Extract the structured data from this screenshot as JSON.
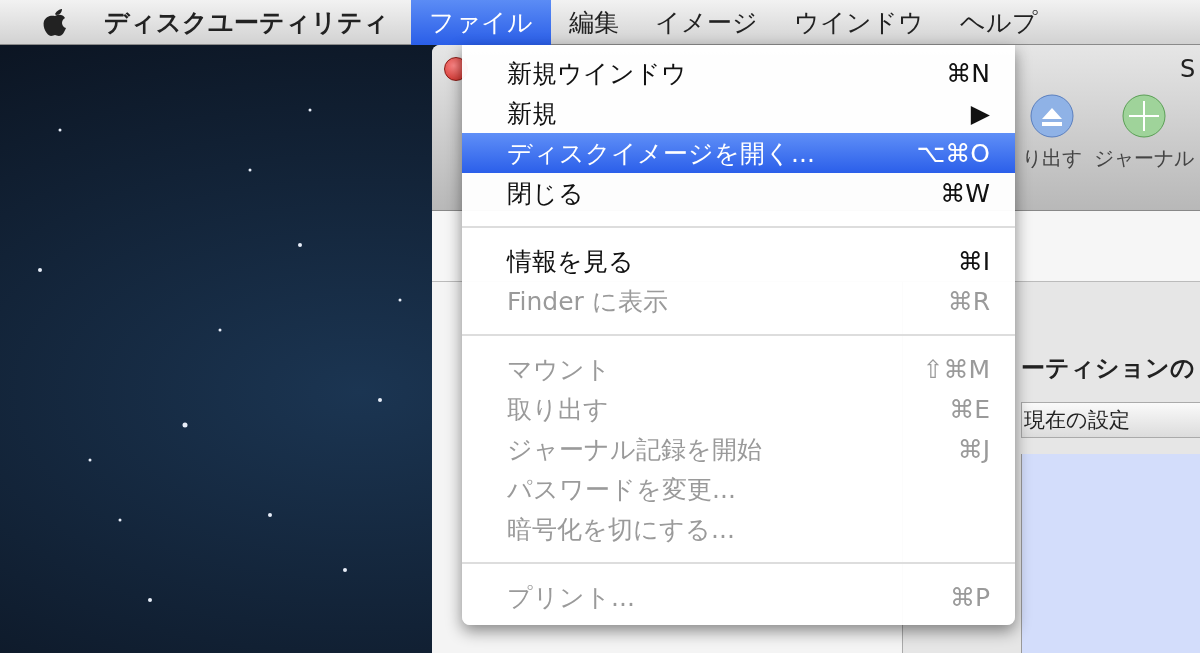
{
  "menubar": {
    "app": "ディスクユーティリティ",
    "menus": [
      {
        "label": "ファイル",
        "selected": true
      },
      {
        "label": "編集",
        "selected": false
      },
      {
        "label": "イメージ",
        "selected": false
      },
      {
        "label": "ウインドウ",
        "selected": false
      },
      {
        "label": "ヘルプ",
        "selected": false
      }
    ]
  },
  "menu": {
    "items": [
      {
        "kind": "item",
        "label": "新規ウインドウ",
        "shortcut": "⌘N",
        "disabled": false,
        "selected": false
      },
      {
        "kind": "item",
        "label": "新規",
        "shortcut": "▶",
        "disabled": false,
        "selected": false
      },
      {
        "kind": "item",
        "label": "ディスクイメージを開く...",
        "shortcut": "⌥⌘O",
        "disabled": false,
        "selected": true
      },
      {
        "kind": "item",
        "label": "閉じる",
        "shortcut": "⌘W",
        "disabled": false,
        "selected": false
      },
      {
        "kind": "separator"
      },
      {
        "kind": "item",
        "label": "情報を見る",
        "shortcut": "⌘I",
        "disabled": false,
        "selected": false
      },
      {
        "kind": "item",
        "label": "Finder に表示",
        "shortcut": "⌘R",
        "disabled": true,
        "selected": false
      },
      {
        "kind": "separator"
      },
      {
        "kind": "item",
        "label": "マウント",
        "shortcut": "⇧⌘M",
        "disabled": true,
        "selected": false
      },
      {
        "kind": "item",
        "label": "取り出す",
        "shortcut": "⌘E",
        "disabled": true,
        "selected": false
      },
      {
        "kind": "item",
        "label": "ジャーナル記録を開始",
        "shortcut": "⌘J",
        "disabled": true,
        "selected": false
      },
      {
        "kind": "item",
        "label": "パスワードを変更...",
        "disabled": true,
        "selected": false
      },
      {
        "kind": "item",
        "label": "暗号化を切にする...",
        "disabled": true,
        "selected": false
      },
      {
        "kind": "separator"
      },
      {
        "kind": "item",
        "label": "プリント...",
        "shortcut": "⌘P",
        "disabled": true,
        "selected": false
      }
    ]
  },
  "window": {
    "title": "S",
    "toolbar": [
      {
        "kind": "eject",
        "label": "り出す"
      },
      {
        "kind": "journal",
        "label": "ジャーナル"
      }
    ],
    "panel": {
      "heading": "ーティションの",
      "column": "現在の設定"
    }
  }
}
